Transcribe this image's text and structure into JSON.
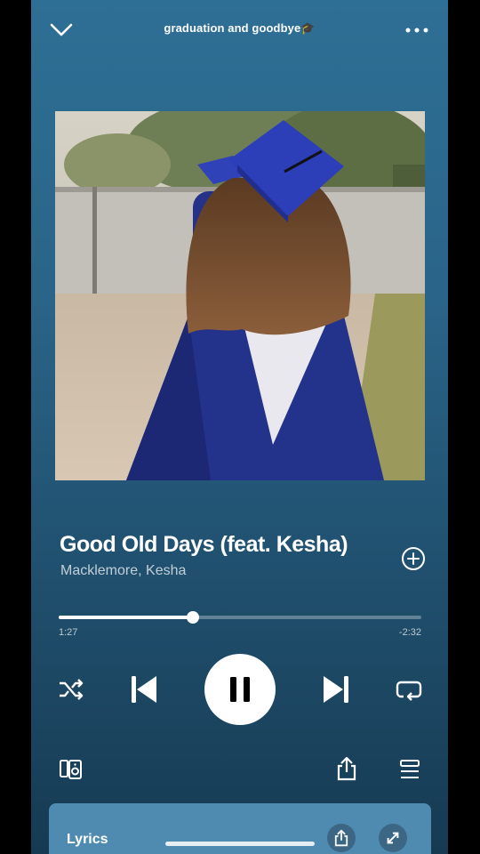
{
  "header": {
    "playlist_title": "graduation and goodbye",
    "playlist_emoji": "🎓",
    "collapse_icon": "chevron-down-icon",
    "more_icon": "more-horizontal-icon"
  },
  "track": {
    "title": "Good Old Days (feat. Kesha)",
    "artists": "Macklemore, Kesha",
    "add_icon": "plus-circle-icon"
  },
  "playback": {
    "elapsed": "1:27",
    "remaining": "-2:32",
    "progress_fraction": 0.37,
    "state": "playing"
  },
  "controls": {
    "shuffle_icon": "shuffle-icon",
    "previous_icon": "skip-previous-icon",
    "pause_icon": "pause-icon",
    "next_icon": "skip-next-icon",
    "repeat_icon": "repeat-icon",
    "devices_icon": "connect-device-icon",
    "share_icon": "share-icon",
    "queue_icon": "queue-icon"
  },
  "lyrics": {
    "label": "Lyrics",
    "share_icon": "share-icon",
    "expand_icon": "expand-icon"
  },
  "colors": {
    "background_top": "#2e6f95",
    "background_bottom": "#163a52",
    "lyrics_card": "#4f8ab0",
    "gown_blue": "#23328a",
    "cap_blue": "#2c3fb8"
  }
}
